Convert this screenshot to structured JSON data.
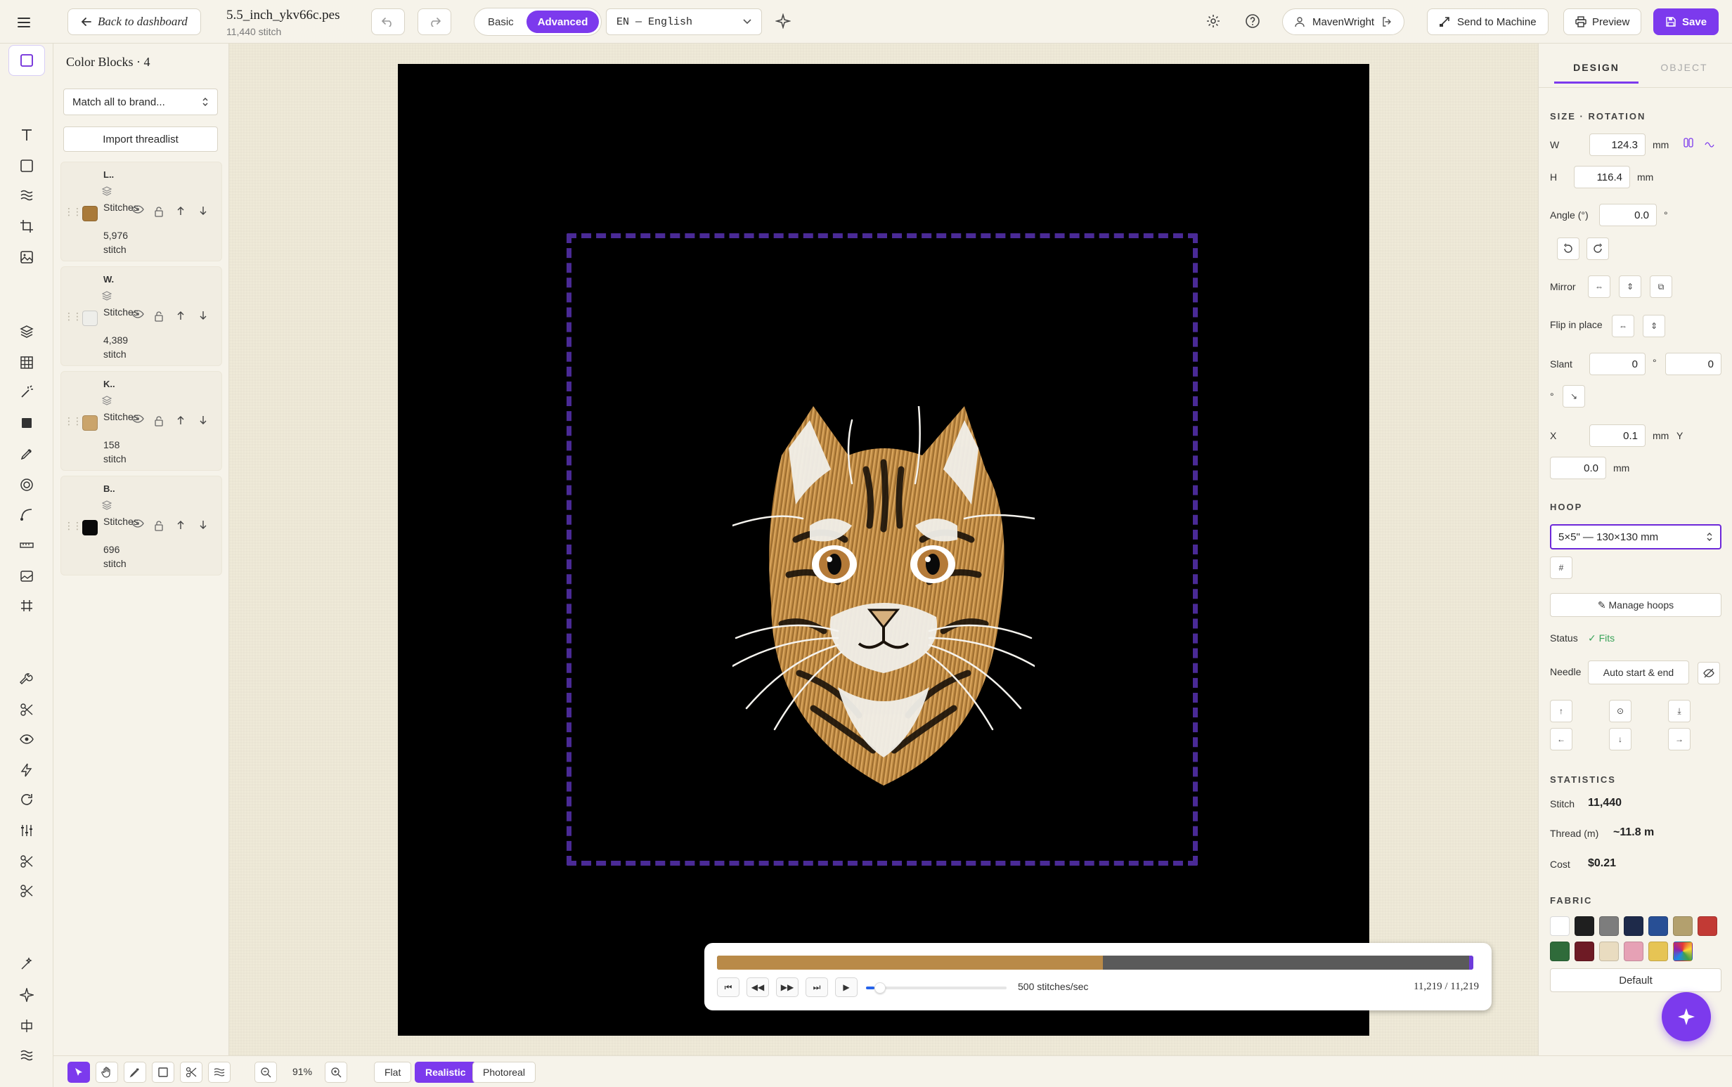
{
  "header": {
    "back_label": "Back to dashboard",
    "file_name": "5.5_inch_ykv66c.pes",
    "file_sub": "11,440 stitch",
    "modes": [
      "Basic",
      "Advanced"
    ],
    "active_mode": "Advanced",
    "language": "EN — English",
    "user": "MavenWright",
    "send_label": "Send to Machine",
    "preview_label": "Preview",
    "save_label": "Save"
  },
  "blocks_panel": {
    "title": "Color Blocks · 4",
    "match_label": "Match all to brand...",
    "import_label": "Import threadlist",
    "blocks": [
      {
        "name": "L..",
        "color": "#a97a3a",
        "stitches_label": "Stitches",
        "count": "5,976",
        "unit": "stitch"
      },
      {
        "name": "W.",
        "color": "#eeeeea",
        "stitches_label": "Stitches",
        "count": "4,389",
        "unit": "stitch"
      },
      {
        "name": "K..",
        "color": "#caa46b",
        "stitches_label": "Stitches",
        "count": "158",
        "unit": "stitch"
      },
      {
        "name": "B..",
        "color": "#0a0a0a",
        "stitches_label": "Stitches",
        "count": "696",
        "unit": "stitch"
      }
    ]
  },
  "player": {
    "progress_fraction": 0.51,
    "speed_fraction": 0.06,
    "speed_label": "500 stitches/sec",
    "counter": "11,219 / 11,219"
  },
  "bottom": {
    "zoom": "91%",
    "views": [
      "Flat",
      "Realistic",
      "Photoreal"
    ],
    "active_view": "Realistic"
  },
  "right_panel": {
    "tabs": [
      "DESIGN",
      "OBJECT"
    ],
    "size_title": "SIZE · ROTATION",
    "w_label": "W",
    "w_value": "124.3",
    "h_label": "H",
    "h_value": "116.4",
    "unit_mm": "mm",
    "angle_label": "Angle (°)",
    "angle_value": "0.0",
    "degree": "°",
    "mirror_label": "Mirror",
    "flip_label": "Flip in place",
    "slant_label": "Slant",
    "slant_x": "0",
    "slant_y": "0",
    "x_label": "X",
    "x_value": "0.1",
    "y_label": "Y",
    "y_value": "0.0",
    "hoop_title": "HOOP",
    "hoop_value": "5×5\" — 130×130 mm",
    "manage_hoops": "✎ Manage hoops",
    "status_label": "Status",
    "status_value": "✓ Fits",
    "needle_label": "Needle",
    "needle_value": "Auto start & end",
    "stats_title": "STATISTICS",
    "stitch_label": "Stitch",
    "stitch_value": "11,440",
    "thread_label": "Thread (m)",
    "thread_value": "~11.8 m",
    "cost_label": "Cost",
    "cost_value": "$0.21",
    "fabric_title": "FABRIC",
    "fabric_colors": [
      "#ffffff",
      "#1f1f1f",
      "#7d7d7d",
      "#1e2a4a",
      "#284f95",
      "#b3a06e",
      "#c23a35",
      "#2f6b3a",
      "#6e1b25",
      "#e9dcc0",
      "#e6a1b5",
      "#e6c454",
      "rainbow"
    ],
    "default_label": "Default"
  },
  "colors": {
    "accent": "#7c3aed",
    "hoop": "#4a2a96"
  }
}
